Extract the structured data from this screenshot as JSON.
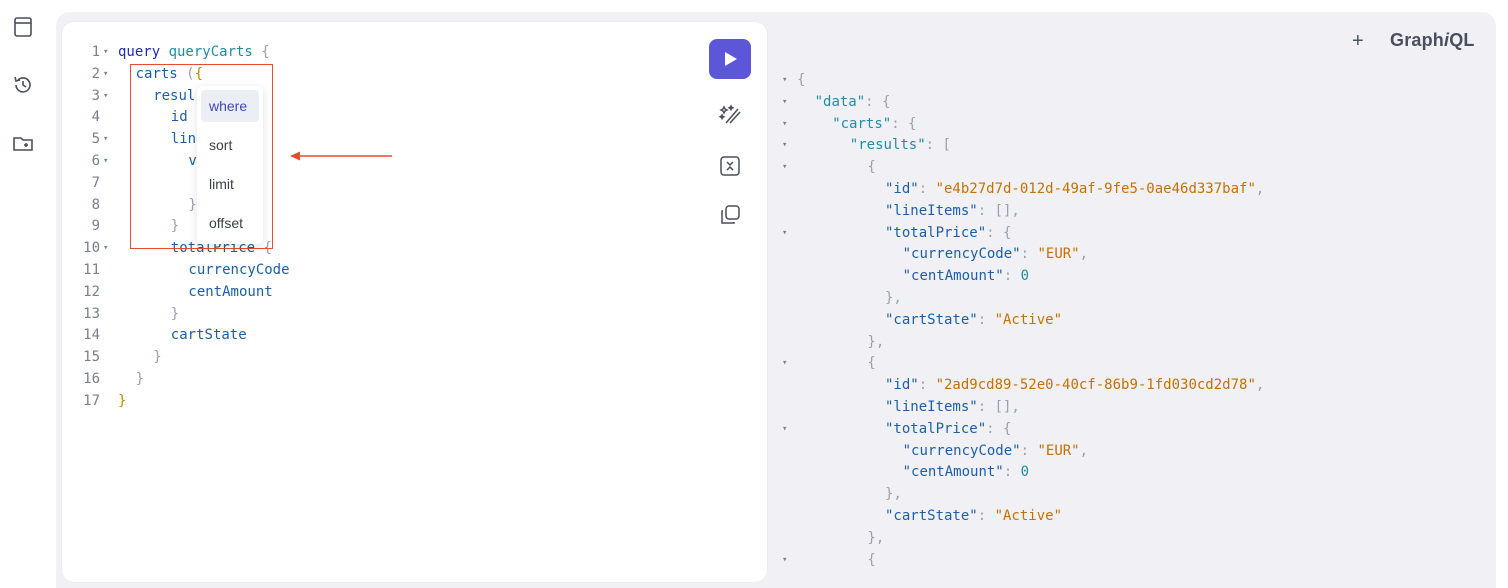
{
  "brand": {
    "prefix": "Graph",
    "italic": "i",
    "suffix": "QL"
  },
  "header": {
    "plus_label": "+"
  },
  "sidebar": {
    "items": [
      {
        "icon": "docs-icon"
      },
      {
        "icon": "history-icon"
      },
      {
        "icon": "folder-plus-icon"
      }
    ]
  },
  "toolbar": {
    "run": "run-icon",
    "prettify": "magic-wand-icon",
    "merge": "merge-icon",
    "copy": "copy-icon"
  },
  "editor": {
    "line_numbers": [
      "1",
      "2",
      "3",
      "4",
      "5",
      "6",
      "7",
      "8",
      "9",
      "10",
      "11",
      "12",
      "13",
      "14",
      "15",
      "16",
      "17"
    ],
    "lines": [
      {
        "ln": "1",
        "fold": true,
        "indent": 0,
        "tokens": [
          {
            "t": "query ",
            "c": "kw"
          },
          {
            "t": "queryCarts",
            "c": "def"
          },
          {
            "t": " {",
            "c": "punct"
          }
        ]
      },
      {
        "ln": "2",
        "fold": true,
        "indent": 1,
        "tokens": [
          {
            "t": "carts",
            "c": "prop"
          },
          {
            "t": " (",
            "c": "punct"
          },
          {
            "t": "{",
            "c": "brace-gold"
          }
        ]
      },
      {
        "ln": "3",
        "fold": true,
        "indent": 2,
        "tokens": [
          {
            "t": "resul",
            "c": "prop"
          }
        ]
      },
      {
        "ln": "4",
        "fold": false,
        "indent": 3,
        "tokens": [
          {
            "t": "id",
            "c": "prop"
          }
        ]
      },
      {
        "ln": "5",
        "fold": true,
        "indent": 3,
        "tokens": [
          {
            "t": "lin",
            "c": "prop"
          }
        ]
      },
      {
        "ln": "6",
        "fold": true,
        "indent": 4,
        "tokens": [
          {
            "t": "v",
            "c": "prop"
          }
        ]
      },
      {
        "ln": "7",
        "fold": false,
        "indent": 4,
        "tokens": []
      },
      {
        "ln": "8",
        "fold": false,
        "indent": 4,
        "tokens": [
          {
            "t": "}",
            "c": "punct"
          }
        ]
      },
      {
        "ln": "9",
        "fold": false,
        "indent": 3,
        "tokens": [
          {
            "t": "}",
            "c": "punct"
          }
        ]
      },
      {
        "ln": "10",
        "fold": true,
        "indent": 3,
        "tokens": [
          {
            "t": "totalPrice",
            "c": "prop"
          },
          {
            "t": " {",
            "c": "punct"
          }
        ]
      },
      {
        "ln": "11",
        "fold": false,
        "indent": 4,
        "tokens": [
          {
            "t": "currencyCode",
            "c": "prop"
          }
        ]
      },
      {
        "ln": "12",
        "fold": false,
        "indent": 4,
        "tokens": [
          {
            "t": "centAmount",
            "c": "prop"
          }
        ]
      },
      {
        "ln": "13",
        "fold": false,
        "indent": 3,
        "tokens": [
          {
            "t": "}",
            "c": "punct"
          }
        ]
      },
      {
        "ln": "14",
        "fold": false,
        "indent": 3,
        "tokens": [
          {
            "t": "cartState",
            "c": "prop"
          }
        ]
      },
      {
        "ln": "15",
        "fold": false,
        "indent": 2,
        "tokens": [
          {
            "t": "}",
            "c": "punct"
          }
        ]
      },
      {
        "ln": "16",
        "fold": false,
        "indent": 1,
        "tokens": [
          {
            "t": "}",
            "c": "punct"
          }
        ]
      },
      {
        "ln": "17",
        "fold": false,
        "indent": 0,
        "tokens": [
          {
            "t": "}",
            "c": "brace-gold"
          }
        ]
      }
    ]
  },
  "autocomplete": {
    "items": [
      {
        "label": "where",
        "active": true
      },
      {
        "label": "sort",
        "active": false
      },
      {
        "label": "limit",
        "active": false
      },
      {
        "label": "offset",
        "active": false
      }
    ]
  },
  "result": {
    "lines": [
      {
        "fold": true,
        "indent": 0,
        "tokens": [
          {
            "t": "{",
            "c": "punct"
          }
        ]
      },
      {
        "fold": true,
        "indent": 1,
        "tokens": [
          {
            "t": "\"data\"",
            "c": "def"
          },
          {
            "t": ": {",
            "c": "punct"
          }
        ]
      },
      {
        "fold": true,
        "indent": 2,
        "tokens": [
          {
            "t": "\"carts\"",
            "c": "def"
          },
          {
            "t": ": {",
            "c": "punct"
          }
        ]
      },
      {
        "fold": true,
        "indent": 3,
        "tokens": [
          {
            "t": "\"results\"",
            "c": "def"
          },
          {
            "t": ": [",
            "c": "punct"
          }
        ]
      },
      {
        "fold": true,
        "indent": 4,
        "tokens": [
          {
            "t": "{",
            "c": "punct"
          }
        ]
      },
      {
        "fold": false,
        "indent": 5,
        "tokens": [
          {
            "t": "\"id\"",
            "c": "prop"
          },
          {
            "t": ": ",
            "c": "punct"
          },
          {
            "t": "\"e4b27d7d-012d-49af-9fe5-0ae46d337baf\"",
            "c": "str"
          },
          {
            "t": ",",
            "c": "punct"
          }
        ]
      },
      {
        "fold": false,
        "indent": 5,
        "tokens": [
          {
            "t": "\"lineItems\"",
            "c": "prop"
          },
          {
            "t": ": [],",
            "c": "punct"
          }
        ]
      },
      {
        "fold": true,
        "indent": 5,
        "tokens": [
          {
            "t": "\"totalPrice\"",
            "c": "prop"
          },
          {
            "t": ": {",
            "c": "punct"
          }
        ]
      },
      {
        "fold": false,
        "indent": 6,
        "tokens": [
          {
            "t": "\"currencyCode\"",
            "c": "prop"
          },
          {
            "t": ": ",
            "c": "punct"
          },
          {
            "t": "\"EUR\"",
            "c": "str"
          },
          {
            "t": ",",
            "c": "punct"
          }
        ]
      },
      {
        "fold": false,
        "indent": 6,
        "tokens": [
          {
            "t": "\"centAmount\"",
            "c": "prop"
          },
          {
            "t": ": ",
            "c": "punct"
          },
          {
            "t": "0",
            "c": "num"
          }
        ]
      },
      {
        "fold": false,
        "indent": 5,
        "tokens": [
          {
            "t": "},",
            "c": "punct"
          }
        ]
      },
      {
        "fold": false,
        "indent": 5,
        "tokens": [
          {
            "t": "\"cartState\"",
            "c": "prop"
          },
          {
            "t": ": ",
            "c": "punct"
          },
          {
            "t": "\"Active\"",
            "c": "str"
          }
        ]
      },
      {
        "fold": false,
        "indent": 4,
        "tokens": [
          {
            "t": "},",
            "c": "punct"
          }
        ]
      },
      {
        "fold": true,
        "indent": 4,
        "tokens": [
          {
            "t": "{",
            "c": "punct"
          }
        ]
      },
      {
        "fold": false,
        "indent": 5,
        "tokens": [
          {
            "t": "\"id\"",
            "c": "prop"
          },
          {
            "t": ": ",
            "c": "punct"
          },
          {
            "t": "\"2ad9cd89-52e0-40cf-86b9-1fd030cd2d78\"",
            "c": "str"
          },
          {
            "t": ",",
            "c": "punct"
          }
        ]
      },
      {
        "fold": false,
        "indent": 5,
        "tokens": [
          {
            "t": "\"lineItems\"",
            "c": "prop"
          },
          {
            "t": ": [],",
            "c": "punct"
          }
        ]
      },
      {
        "fold": true,
        "indent": 5,
        "tokens": [
          {
            "t": "\"totalPrice\"",
            "c": "prop"
          },
          {
            "t": ": {",
            "c": "punct"
          }
        ]
      },
      {
        "fold": false,
        "indent": 6,
        "tokens": [
          {
            "t": "\"currencyCode\"",
            "c": "prop"
          },
          {
            "t": ": ",
            "c": "punct"
          },
          {
            "t": "\"EUR\"",
            "c": "str"
          },
          {
            "t": ",",
            "c": "punct"
          }
        ]
      },
      {
        "fold": false,
        "indent": 6,
        "tokens": [
          {
            "t": "\"centAmount\"",
            "c": "prop"
          },
          {
            "t": ": ",
            "c": "punct"
          },
          {
            "t": "0",
            "c": "num"
          }
        ]
      },
      {
        "fold": false,
        "indent": 5,
        "tokens": [
          {
            "t": "},",
            "c": "punct"
          }
        ]
      },
      {
        "fold": false,
        "indent": 5,
        "tokens": [
          {
            "t": "\"cartState\"",
            "c": "prop"
          },
          {
            "t": ": ",
            "c": "punct"
          },
          {
            "t": "\"Active\"",
            "c": "str"
          }
        ]
      },
      {
        "fold": false,
        "indent": 4,
        "tokens": [
          {
            "t": "},",
            "c": "punct"
          }
        ]
      },
      {
        "fold": true,
        "indent": 4,
        "tokens": [
          {
            "t": "{",
            "c": "punct"
          }
        ]
      }
    ]
  },
  "colors": {
    "run_button": "#5b57d8",
    "annotation": "#e54d2e",
    "keyword": "#1e2bb8",
    "string": "#c77000"
  }
}
